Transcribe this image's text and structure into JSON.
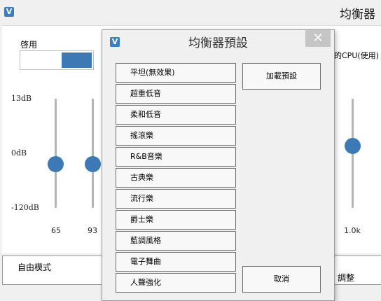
{
  "app": {
    "title": "均衡器",
    "enable_label": "啓用",
    "cpu_text": "的CPU(使用)",
    "db_labels": [
      "13dB",
      "0dB",
      "-120dB"
    ],
    "freq_labels": [
      "65",
      "93",
      "1.0k"
    ],
    "mode_label": "自由模式",
    "adjust_label": "調整",
    "toggle_state": "off"
  },
  "dialog": {
    "title": "均衡器預設",
    "close_glyph": "✕",
    "presets": [
      "平坦(無效果)",
      "超重低音",
      "柔和低音",
      "搖滾樂",
      "R&B音樂",
      "古典樂",
      "流行樂",
      "爵士樂",
      "藍調風格",
      "電子舞曲",
      "人聲強化"
    ],
    "load_button": "加載預設",
    "cancel_button": "取消"
  },
  "colors": {
    "accent": "#3d7ab5",
    "logo": "#3a7fc0"
  }
}
